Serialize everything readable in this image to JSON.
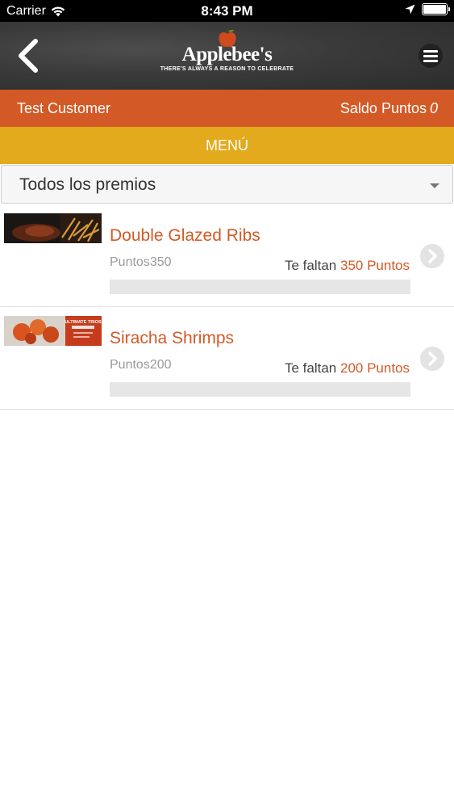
{
  "status_bar": {
    "carrier": "Carrier",
    "time": "8:43 PM"
  },
  "header": {
    "brand": "Applebee's",
    "tagline": "THERE'S ALWAYS A REASON TO CELEBRATE",
    "icons": [
      "back-chevron-icon",
      "apple-logo-icon",
      "hamburger-menu-icon"
    ]
  },
  "user_bar": {
    "name": "Test Customer",
    "points_label": "Saldo Puntos",
    "points_value": "0"
  },
  "menu_bar": {
    "label": "MENÚ"
  },
  "filter": {
    "selected": "Todos los premios"
  },
  "colors": {
    "accent_orange": "#d35a26",
    "menu_yellow": "#e2aa1c",
    "header_dark": "#3a3a3a"
  },
  "rewards": [
    {
      "title": "Double Glazed Ribs",
      "cost": "Puntos350",
      "need_prefix": "Te faltan",
      "need_points": "350 Puntos",
      "progress": 0
    },
    {
      "title": "Siracha Shrimps",
      "cost": "Puntos200",
      "need_prefix": "Te faltan",
      "need_points": "200 Puntos",
      "progress": 0,
      "thumb_text": "ULTIMATE TRIOS"
    }
  ]
}
